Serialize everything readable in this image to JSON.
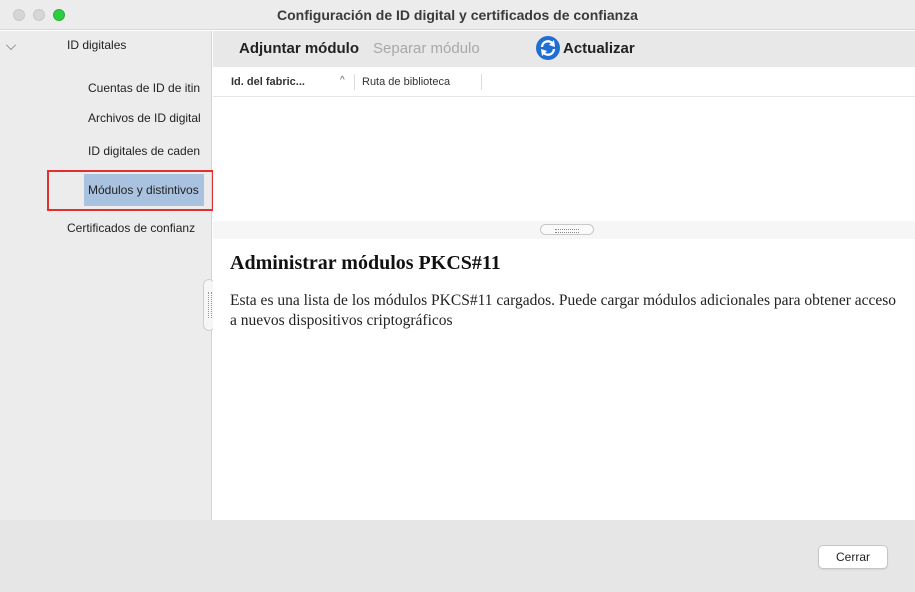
{
  "window": {
    "title": "Configuración de ID digital y certificados de confianza"
  },
  "sidebar": {
    "root": "ID digitales",
    "items": [
      {
        "label": "Cuentas de ID de itin"
      },
      {
        "label": "Archivos de ID digital"
      },
      {
        "label": "ID digitales de caden"
      },
      {
        "label": "Módulos y distintivos",
        "selected": true
      }
    ],
    "trust_item": "Certificados de confianz"
  },
  "toolbar": {
    "attach_label": "Adjuntar módulo",
    "detach_label": "Separar módulo",
    "refresh_label": "Actualizar",
    "refresh_icon": "refresh-icon",
    "refresh_color": "#1f6fd1"
  },
  "table": {
    "columns": [
      {
        "label": "Id. del fabric...",
        "sort": "^"
      },
      {
        "label": "Ruta de biblioteca"
      }
    ],
    "rows": []
  },
  "description": {
    "heading": "Administrar módulos PKCS#11",
    "body": "Esta es una lista de los módulos PKCS#11 cargados. Puede cargar módulos adicionales para obtener acceso a nuevos dispositivos criptográficos"
  },
  "footer": {
    "close_label": "Cerrar"
  },
  "colors": {
    "selection": "#a9c2df",
    "annotation_box": "#e03131"
  }
}
